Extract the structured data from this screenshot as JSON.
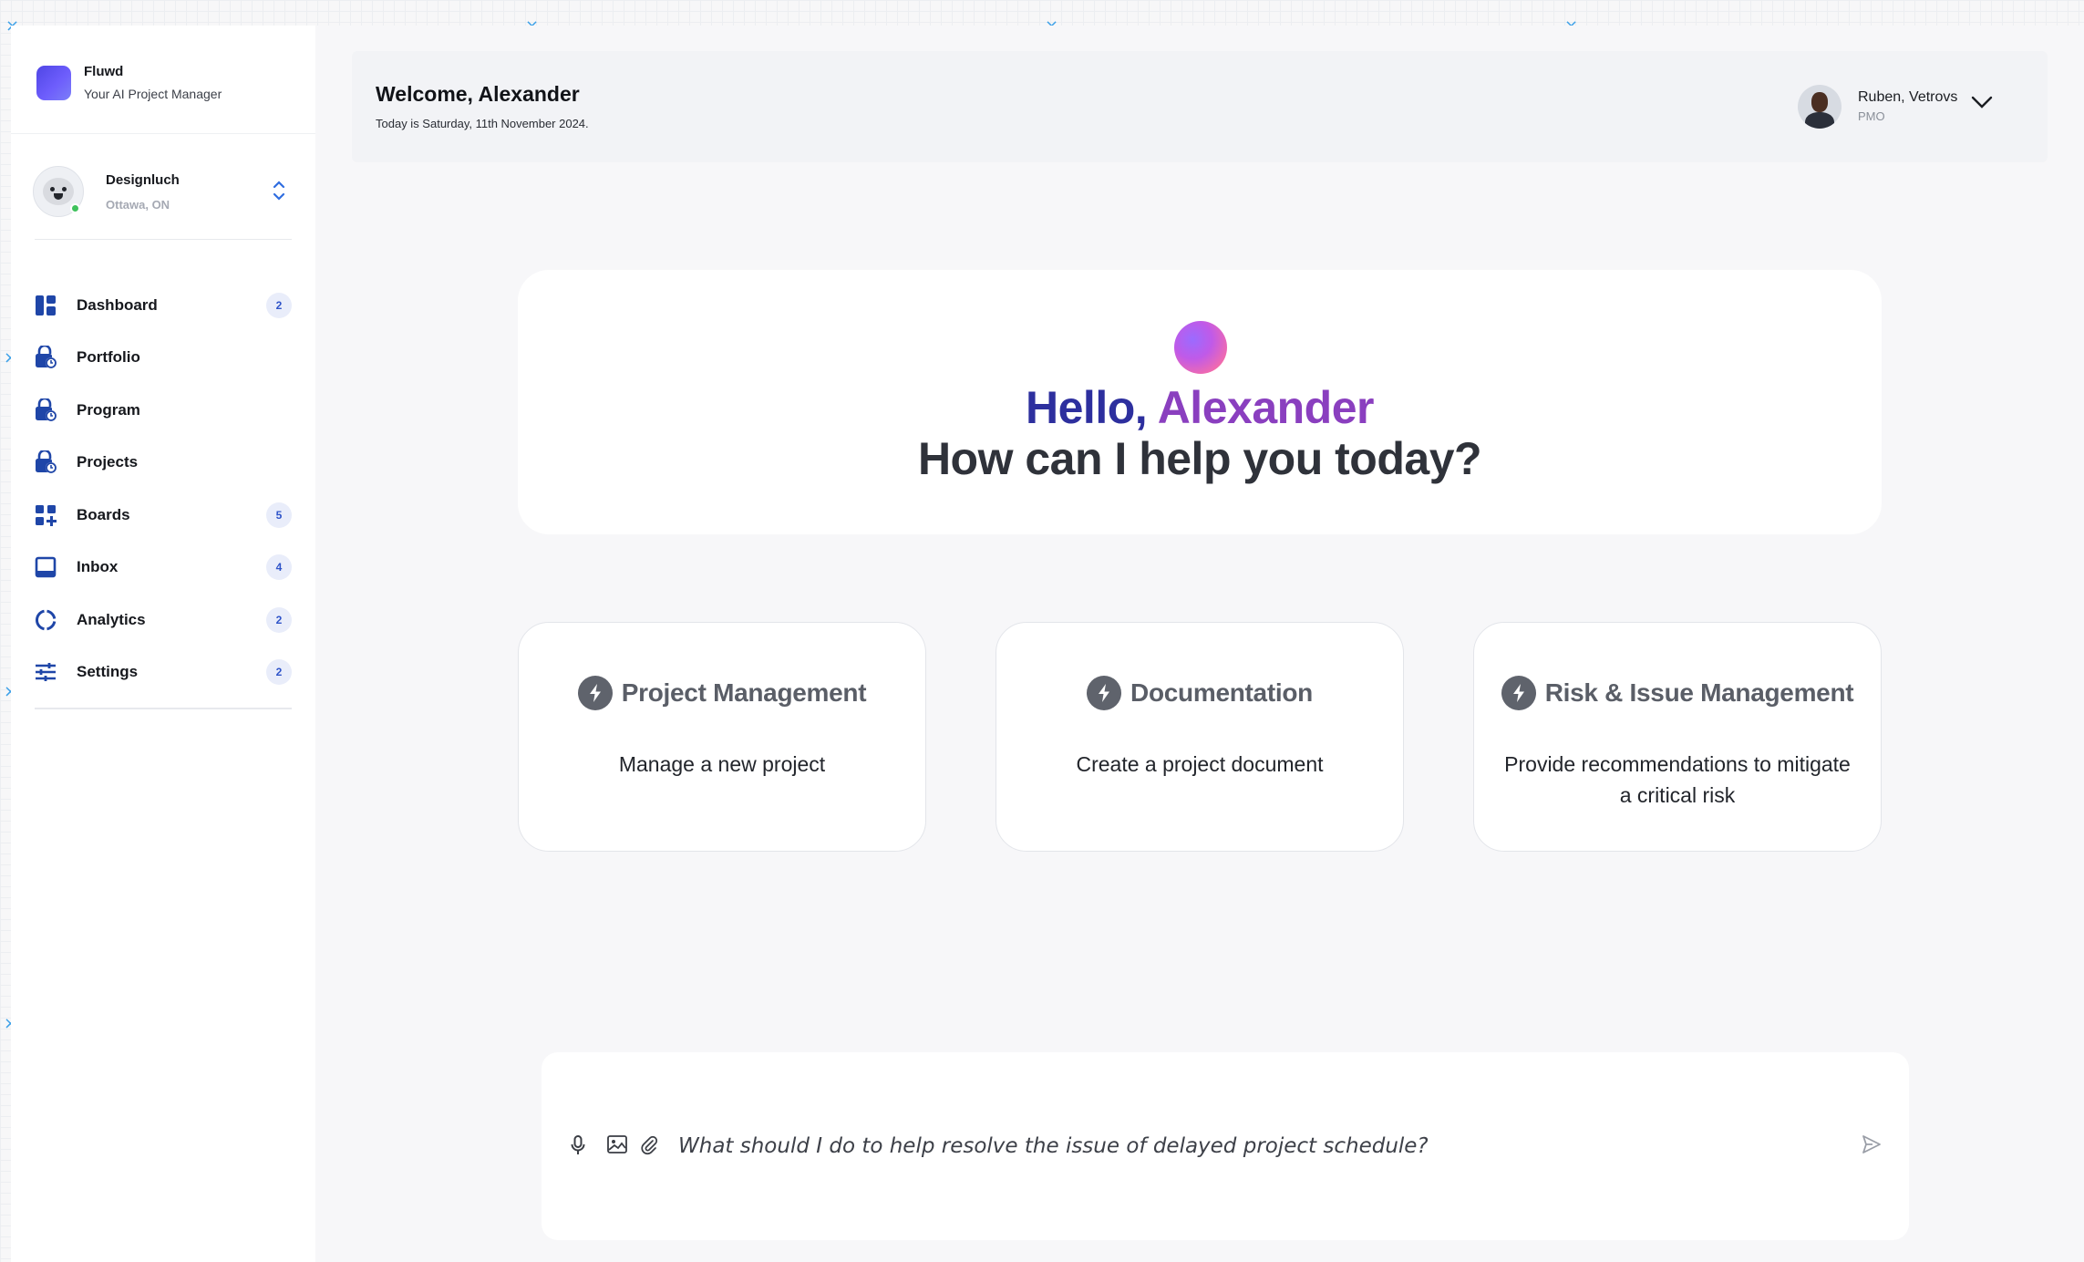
{
  "brand": {
    "name": "Fluwd",
    "subtitle": "Your AI Project Manager"
  },
  "workspace": {
    "name": "Designluch",
    "location": "Ottawa, ON"
  },
  "sidebar": {
    "items": [
      {
        "label": "Dashboard",
        "badge": "2",
        "icon": "dashboard-icon"
      },
      {
        "label": "Portfolio",
        "badge": null,
        "icon": "lock-clock-icon"
      },
      {
        "label": "Program",
        "badge": null,
        "icon": "lock-clock-icon"
      },
      {
        "label": "Projects",
        "badge": null,
        "icon": "lock-clock-icon"
      },
      {
        "label": "Boards",
        "badge": "5",
        "icon": "boards-icon"
      },
      {
        "label": "Inbox",
        "badge": "4",
        "icon": "inbox-icon"
      },
      {
        "label": "Analytics",
        "badge": "2",
        "icon": "analytics-icon"
      },
      {
        "label": "Settings",
        "badge": "2",
        "icon": "sliders-icon"
      }
    ]
  },
  "header": {
    "welcome": "Welcome, Alexander",
    "date": "Today is Saturday, 11th November 2024.",
    "user": {
      "name": "Ruben, Vetrovs",
      "role": "PMO"
    }
  },
  "hero": {
    "hello": "Hello,",
    "name": "Alexander",
    "question": "How can I help you today?"
  },
  "cards": [
    {
      "title": "Project Management",
      "description": "Manage a new project"
    },
    {
      "title": "Documentation",
      "description": "Create a project document"
    },
    {
      "title": "Risk & Issue Management",
      "description": "Provide recommendations to mitigate a critical risk"
    }
  ],
  "composer": {
    "placeholder": "What should I do to help resolve the issue of delayed project schedule?"
  },
  "colors": {
    "accent": "#1f46a8",
    "badge_bg": "#e9edfa",
    "hello_start": "#2d2f9e",
    "hello_end": "#8a3fbf",
    "status_online": "#3fc25c"
  }
}
